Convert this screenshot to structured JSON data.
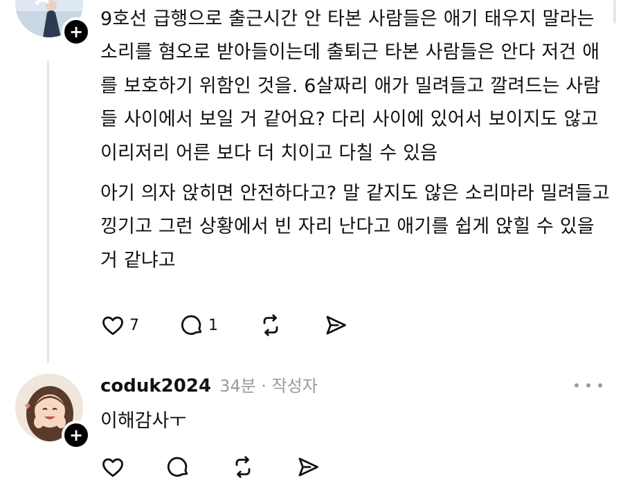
{
  "post": {
    "paragraphs": [
      "9호선 급행으로 출근시간 안 타본 사람들은 애기 태우지 말라는 소리를 혐오로 받아들이는데 출퇴근 타본 사람들은 안다 저건 애를 보호하기 위함인 것을. 6살짜리 애가 밀려들고 깔려드는 사람들 사이에서 보일 거 같어요? 다리 사이에 있어서 보이지도 않고 이리저리 어른 보다 더 치이고 다칠 수 있음",
      "아기 의자 앉히면 안전하다고? 말 같지도 않은 소리마라 밀려들고 낑기고 그런 상황에서 빈 자리 난다고 애기를 쉽게 앉힐 수 있을 거 같냐고"
    ],
    "like_count": "7",
    "reply_count": "1",
    "like_icon": "heart-icon",
    "reply_icon": "comment-icon",
    "repost_icon": "repost-icon",
    "share_icon": "send-icon"
  },
  "reply": {
    "username": "coduk2024",
    "meta": "34분 · 작성자",
    "text": "이해감사ㅜ"
  },
  "follow_badge_glyph": "+",
  "colors": {
    "meta_gray": "#9a9a9a",
    "thread_line": "#e5e5e5",
    "text": "#111111"
  }
}
